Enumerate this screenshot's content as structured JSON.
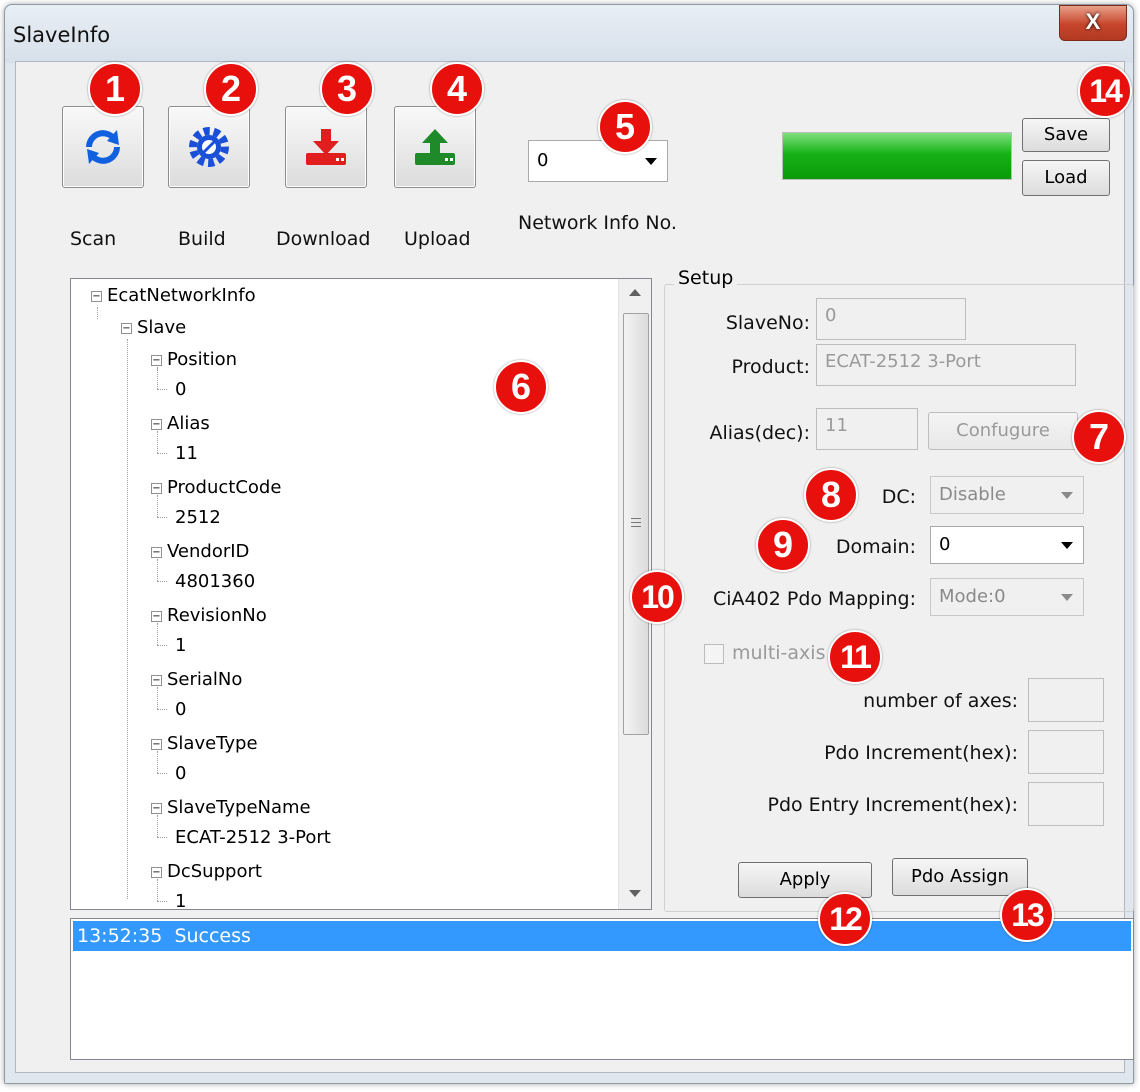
{
  "window": {
    "title": "SlaveInfo",
    "close_label": "X"
  },
  "toolbar": {
    "scan_label": "Scan",
    "build_label": "Build",
    "download_label": "Download",
    "upload_label": "Upload",
    "network_info_value": "0",
    "network_info_label": "Network Info No.",
    "save_label": "Save",
    "load_label": "Load",
    "progress_fraction": 1.0
  },
  "badges": [
    "1",
    "2",
    "3",
    "4",
    "5",
    "6",
    "7",
    "8",
    "9",
    "10",
    "11",
    "12",
    "13",
    "14"
  ],
  "tree": {
    "root": "EcatNetworkInfo",
    "slave": "Slave",
    "items": [
      {
        "label": "Position",
        "value": "0"
      },
      {
        "label": "Alias",
        "value": "11"
      },
      {
        "label": "ProductCode",
        "value": "2512"
      },
      {
        "label": "VendorID",
        "value": "4801360"
      },
      {
        "label": "RevisionNo",
        "value": "1"
      },
      {
        "label": "SerialNo",
        "value": "0"
      },
      {
        "label": "SlaveType",
        "value": "0"
      },
      {
        "label": "SlaveTypeName",
        "value": "ECAT-2512 3-Port"
      },
      {
        "label": "DcSupport",
        "value": "1"
      }
    ]
  },
  "setup": {
    "title": "Setup",
    "slave_no_label": "SlaveNo:",
    "slave_no_value": "0",
    "product_label": "Product:",
    "product_value": "ECAT-2512 3-Port",
    "alias_label": "Alias(dec):",
    "alias_value": "11",
    "configure_label": "Confugure",
    "dc_label": "DC:",
    "dc_value": "Disable",
    "domain_label": "Domain:",
    "domain_value": "0",
    "cia_label": "CiA402 Pdo Mapping:",
    "cia_value": "Mode:0",
    "multi_axis_label": "multi-axis",
    "num_axes_label": "number of axes:",
    "pdo_inc_label": "Pdo Increment(hex):",
    "pdo_entry_inc_label": "Pdo Entry Increment(hex):",
    "apply_label": "Apply",
    "pdo_assign_label": "Pdo Assign"
  },
  "log": {
    "time": "13:52:35",
    "message": "Success"
  },
  "colors": {
    "badge": "#e8100c",
    "progress": "#17b217",
    "selection": "#3399ff"
  }
}
